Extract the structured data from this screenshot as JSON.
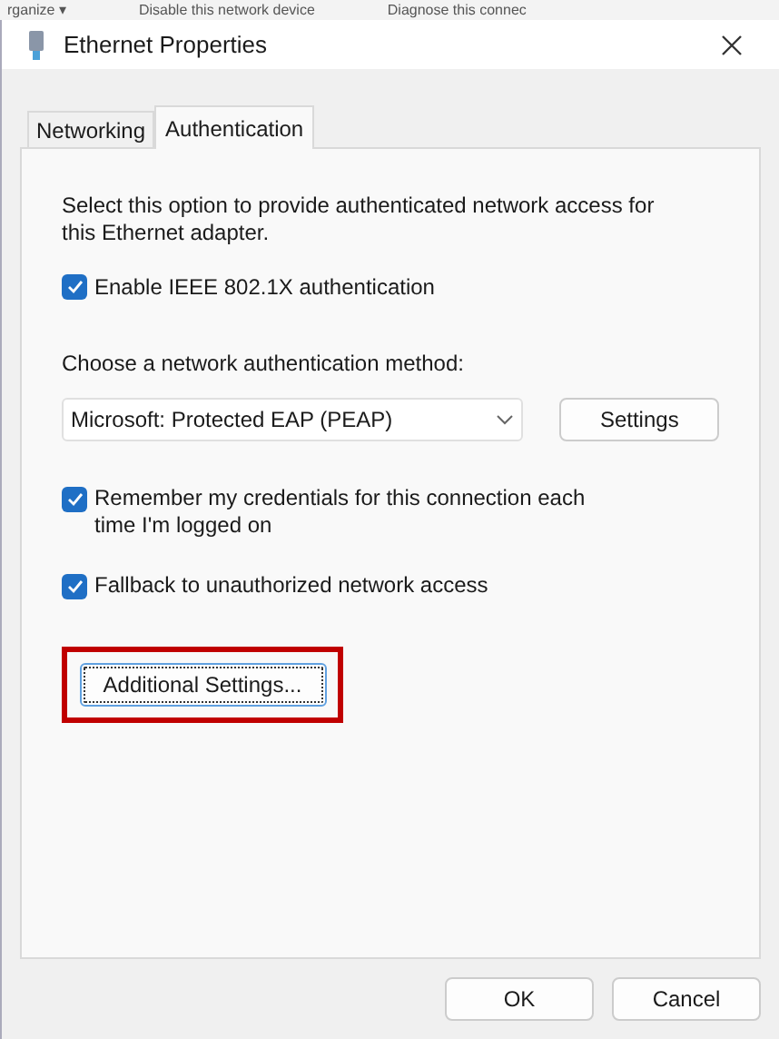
{
  "background_toolbar": [
    "rganize ▾",
    "Disable this network device",
    "Diagnose this connec"
  ],
  "window": {
    "title": "Ethernet Properties"
  },
  "tabs": [
    {
      "label": "Networking",
      "selected": false
    },
    {
      "label": "Authentication",
      "selected": true
    }
  ],
  "description": "Select this option to provide authenticated network access for this Ethernet adapter.",
  "enable_option": {
    "label": "Enable IEEE 802.1X authentication",
    "checked": true
  },
  "method": {
    "label": "Choose a network authentication method:",
    "value": "Microsoft: Protected EAP (PEAP)",
    "settings_button": "Settings"
  },
  "options": [
    {
      "label": "Remember my credentials for this connection each time I'm logged on",
      "checked": true
    },
    {
      "label": "Fallback to unauthorized network access",
      "checked": true
    }
  ],
  "additional_button": {
    "label": "Additional Settings...",
    "highlighted": true
  },
  "buttons": [
    "OK",
    "Cancel"
  ]
}
